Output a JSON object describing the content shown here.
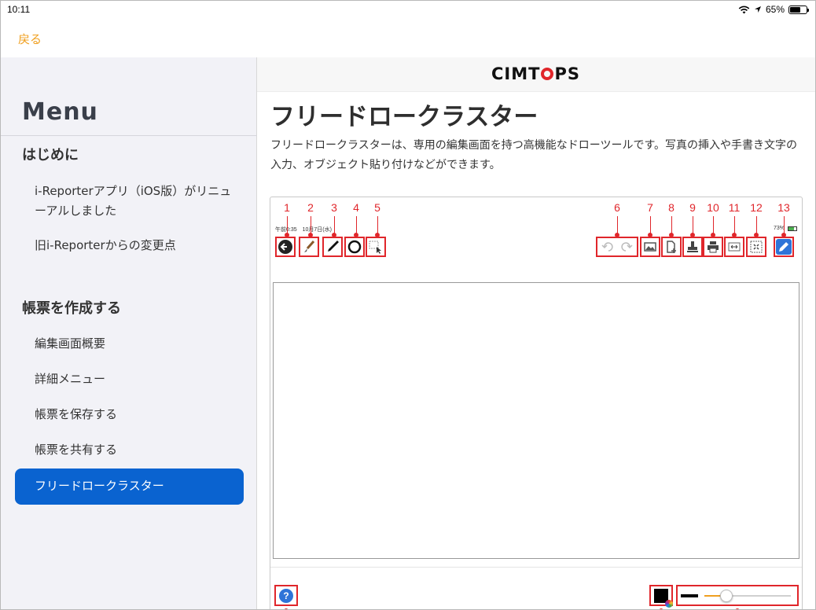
{
  "status_bar": {
    "time": "10:11",
    "battery": "65%",
    "battery_level": 0.65
  },
  "nav": {
    "back_label": "戻る"
  },
  "sidebar": {
    "title": "Menu",
    "sections": [
      {
        "heading": "はじめに",
        "items": [
          {
            "label": "i-Reporterアプリ（iOS版）がリニューアルしました"
          },
          {
            "label": "旧i-Reporterからの変更点"
          }
        ]
      },
      {
        "heading": "帳票を作成する",
        "items": [
          {
            "label": "編集画面概要"
          },
          {
            "label": "詳細メニュー"
          },
          {
            "label": "帳票を保存する"
          },
          {
            "label": "帳票を共有する"
          },
          {
            "label": "フリードロークラスター",
            "active": true
          }
        ]
      }
    ]
  },
  "main": {
    "logo": "CIMTOPS",
    "logo_accent": "#e0262b",
    "title": "フリードロークラスター",
    "description": "フリードロークラスターは、専用の編集画面を持つ高機能なドローツールです。写真の挿入や手書き文字の入力、オブジェクト貼り付けなどができます。"
  },
  "figure": {
    "status_left": "午前0:35　10月7日(水)",
    "status_right": "73%",
    "callouts": [
      "1",
      "2",
      "3",
      "4",
      "5",
      "6",
      "7",
      "8",
      "9",
      "10",
      "11",
      "12",
      "13"
    ],
    "toolbar_icons": [
      "back-icon",
      "brush-icon",
      "pen-icon",
      "circle-icon",
      "select-icon",
      "undo-redo-icon",
      "image-icon",
      "document-insert-icon",
      "stamp-icon",
      "printer-icon",
      "fit-width-icon",
      "fit-screen-icon",
      "edit-icon"
    ],
    "help_label": "?",
    "line_width_level": 0.25
  },
  "colors": {
    "accent": "#f0a020",
    "active_item": "#0a63d0",
    "callout_red": "#e0262b"
  }
}
